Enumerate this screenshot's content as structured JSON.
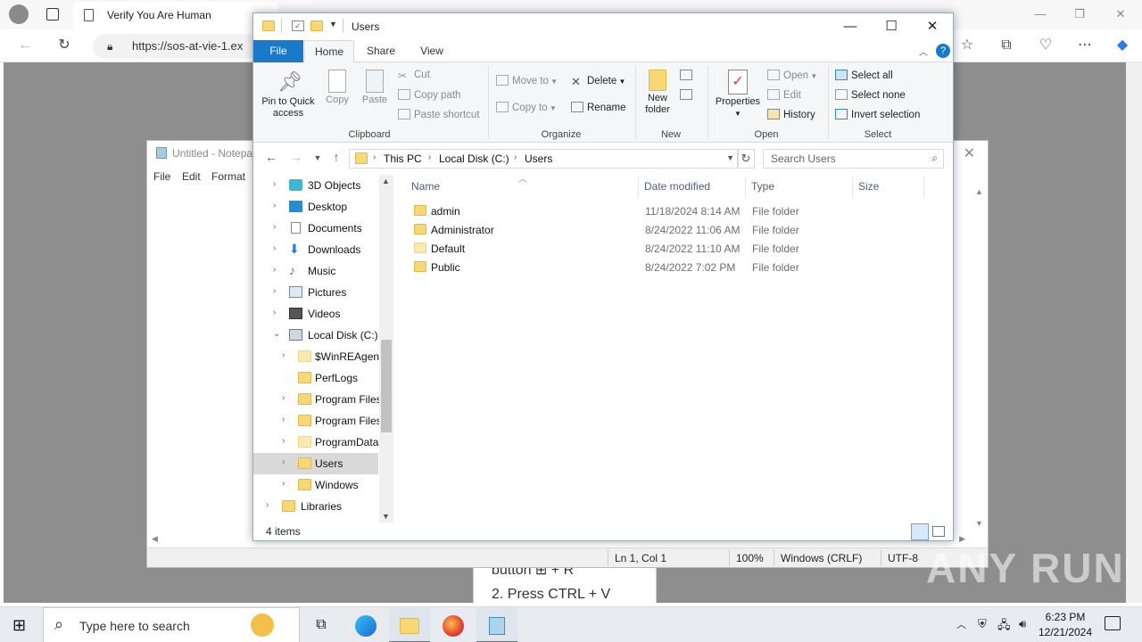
{
  "browser": {
    "tab_title": "Verify You Are Human",
    "url": "https://sos-at-vie-1.ex"
  },
  "notepad": {
    "title": "Untitled - Notepa",
    "menu": [
      "File",
      "Edit",
      "Format"
    ],
    "status": {
      "position": "Ln 1, Col 1",
      "zoom": "100%",
      "line_ending": "Windows (CRLF)",
      "encoding": "UTF-8"
    }
  },
  "popup": {
    "line1": "button  ⊞  + R",
    "line2": "2. Press CTRL + V"
  },
  "explorer": {
    "title": "Users",
    "ribbon_tabs": [
      "File",
      "Home",
      "Share",
      "View"
    ],
    "ribbon": {
      "clipboard": {
        "label": "Clipboard",
        "pin": "Pin to Quick access",
        "copy": "Copy",
        "paste": "Paste",
        "cut": "Cut",
        "copy_path": "Copy path",
        "paste_shortcut": "Paste shortcut"
      },
      "organize": {
        "label": "Organize",
        "move_to": "Move to",
        "copy_to": "Copy to",
        "delete": "Delete",
        "rename": "Rename"
      },
      "new": {
        "label": "New",
        "new_folder": "New folder"
      },
      "open": {
        "label": "Open",
        "properties": "Properties",
        "open": "Open",
        "edit": "Edit",
        "history": "History"
      },
      "select": {
        "label": "Select",
        "select_all": "Select all",
        "select_none": "Select none",
        "invert_selection": "Invert selection"
      }
    },
    "breadcrumb": [
      "This PC",
      "Local Disk (C:)",
      "Users"
    ],
    "search_placeholder": "Search Users",
    "nav_tree": [
      {
        "label": "3D Objects"
      },
      {
        "label": "Desktop"
      },
      {
        "label": "Documents"
      },
      {
        "label": "Downloads"
      },
      {
        "label": "Music"
      },
      {
        "label": "Pictures"
      },
      {
        "label": "Videos"
      },
      {
        "label": "Local Disk (C:)"
      },
      {
        "label": "$WinREAgent"
      },
      {
        "label": "PerfLogs"
      },
      {
        "label": "Program Files"
      },
      {
        "label": "Program Files"
      },
      {
        "label": "ProgramData"
      },
      {
        "label": "Users"
      },
      {
        "label": "Windows"
      },
      {
        "label": "Libraries"
      }
    ],
    "columns": [
      "Name",
      "Date modified",
      "Type",
      "Size"
    ],
    "files": [
      {
        "name": "admin",
        "date": "11/18/2024 8:14 AM",
        "type": "File folder"
      },
      {
        "name": "Administrator",
        "date": "8/24/2022 11:06 AM",
        "type": "File folder"
      },
      {
        "name": "Default",
        "date": "8/24/2022 11:10 AM",
        "type": "File folder"
      },
      {
        "name": "Public",
        "date": "8/24/2022 7:02 PM",
        "type": "File folder"
      }
    ],
    "item_count": "4 items"
  },
  "taskbar": {
    "search_placeholder": "Type here to search",
    "time": "6:23 PM",
    "date": "12/21/2024"
  },
  "watermark": "ANY RUN",
  "colors": {
    "file_tab": "#1979ca",
    "folder": "#f8d775",
    "edge_content_bg": "#8e8e8e"
  }
}
